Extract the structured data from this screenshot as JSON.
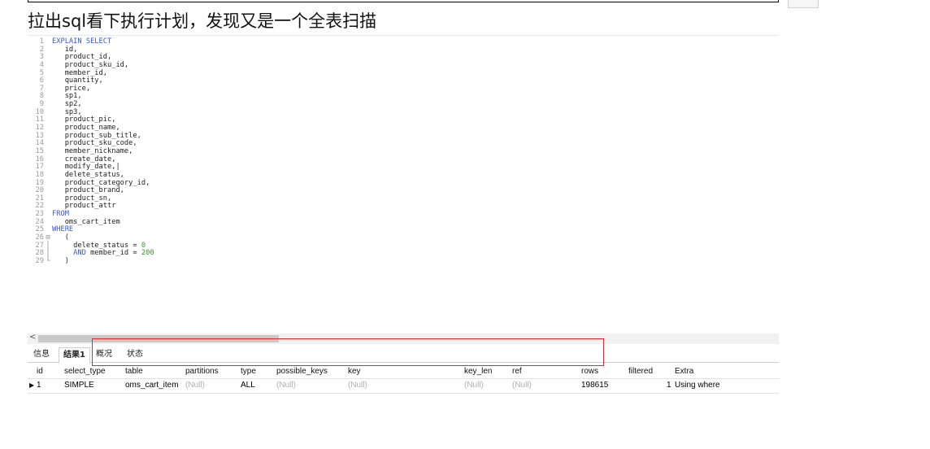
{
  "heading": "拉出sql看下执行计划，发现又是一个全表扫描",
  "editor": {
    "lines": [
      {
        "n": "1",
        "fold": "",
        "parts": [
          {
            "t": "EXPLAIN SELECT",
            "c": "kw"
          }
        ]
      },
      {
        "n": "2",
        "fold": "",
        "parts": [
          {
            "t": "   id,",
            "c": "txt"
          }
        ]
      },
      {
        "n": "3",
        "fold": "",
        "parts": [
          {
            "t": "   product_id,",
            "c": "txt"
          }
        ]
      },
      {
        "n": "4",
        "fold": "",
        "parts": [
          {
            "t": "   product_sku_id,",
            "c": "txt"
          }
        ]
      },
      {
        "n": "5",
        "fold": "",
        "parts": [
          {
            "t": "   member_id,",
            "c": "txt"
          }
        ]
      },
      {
        "n": "6",
        "fold": "",
        "parts": [
          {
            "t": "   quantity,",
            "c": "txt"
          }
        ]
      },
      {
        "n": "7",
        "fold": "",
        "parts": [
          {
            "t": "   price,",
            "c": "txt"
          }
        ]
      },
      {
        "n": "8",
        "fold": "",
        "parts": [
          {
            "t": "   sp1,",
            "c": "txt"
          }
        ]
      },
      {
        "n": "9",
        "fold": "",
        "parts": [
          {
            "t": "   sp2,",
            "c": "txt"
          }
        ]
      },
      {
        "n": "10",
        "fold": "",
        "parts": [
          {
            "t": "   sp3,",
            "c": "txt"
          }
        ]
      },
      {
        "n": "11",
        "fold": "",
        "parts": [
          {
            "t": "   product_pic,",
            "c": "txt"
          }
        ]
      },
      {
        "n": "12",
        "fold": "",
        "parts": [
          {
            "t": "   product_name,",
            "c": "txt"
          }
        ]
      },
      {
        "n": "13",
        "fold": "",
        "parts": [
          {
            "t": "   product_sub_title,",
            "c": "txt"
          }
        ]
      },
      {
        "n": "14",
        "fold": "",
        "parts": [
          {
            "t": "   product_sku_code,",
            "c": "txt"
          }
        ]
      },
      {
        "n": "15",
        "fold": "",
        "parts": [
          {
            "t": "   member_nickname,",
            "c": "txt"
          }
        ]
      },
      {
        "n": "16",
        "fold": "",
        "parts": [
          {
            "t": "   create_date,",
            "c": "txt"
          }
        ]
      },
      {
        "n": "17",
        "fold": "",
        "parts": [
          {
            "t": "   modify_date,|",
            "c": "txt"
          }
        ]
      },
      {
        "n": "18",
        "fold": "",
        "parts": [
          {
            "t": "   delete_status,",
            "c": "txt"
          }
        ]
      },
      {
        "n": "19",
        "fold": "",
        "parts": [
          {
            "t": "   product_category_id,",
            "c": "txt"
          }
        ]
      },
      {
        "n": "20",
        "fold": "",
        "parts": [
          {
            "t": "   product_brand,",
            "c": "txt"
          }
        ]
      },
      {
        "n": "21",
        "fold": "",
        "parts": [
          {
            "t": "   product_sn,",
            "c": "txt"
          }
        ]
      },
      {
        "n": "22",
        "fold": "",
        "parts": [
          {
            "t": "   product_attr",
            "c": "txt"
          }
        ]
      },
      {
        "n": "23",
        "fold": "",
        "parts": [
          {
            "t": "FROM",
            "c": "kw"
          }
        ]
      },
      {
        "n": "24",
        "fold": "",
        "parts": [
          {
            "t": "   oms_cart_item",
            "c": "txt"
          }
        ]
      },
      {
        "n": "25",
        "fold": "",
        "parts": [
          {
            "t": "WHERE",
            "c": "kw"
          }
        ]
      },
      {
        "n": "26",
        "fold": "⊟",
        "parts": [
          {
            "t": "   (",
            "c": "txt"
          }
        ]
      },
      {
        "n": "27",
        "fold": "│",
        "parts": [
          {
            "t": "     delete_status = ",
            "c": "txt"
          },
          {
            "t": "0",
            "c": "num"
          }
        ]
      },
      {
        "n": "28",
        "fold": "│",
        "parts": [
          {
            "t": "     ",
            "c": "txt"
          },
          {
            "t": "AND",
            "c": "kw"
          },
          {
            "t": " member_id = ",
            "c": "txt"
          },
          {
            "t": "200",
            "c": "num"
          }
        ]
      },
      {
        "n": "29",
        "fold": "└",
        "parts": [
          {
            "t": "   )",
            "c": "txt"
          }
        ]
      }
    ]
  },
  "scrollbar": {
    "left_arrow": "<"
  },
  "tabs": [
    {
      "label": "信息",
      "active": false
    },
    {
      "label": "结果1",
      "active": true
    },
    {
      "label": "概况",
      "active": false
    },
    {
      "label": "状态",
      "active": false
    }
  ],
  "grid": {
    "columns": [
      "id",
      "select_type",
      "table",
      "partitions",
      "type",
      "possible_keys",
      "key",
      "key_len",
      "ref",
      "rows",
      "filtered",
      "Extra"
    ],
    "row": {
      "marker": "▶",
      "id": "1",
      "select_type": "SIMPLE",
      "table": "oms_cart_item",
      "partitions": "(Null)",
      "type": "ALL",
      "possible_keys": "(Null)",
      "key": "(Null)",
      "key_len": "(Null)",
      "ref": "(Null)",
      "rows": "198615",
      "filtered": "1",
      "Extra": "Using where"
    }
  },
  "colors": {
    "highlight": "#e0292b",
    "keyword": "#3b57d6",
    "number": "#2e9a2e"
  }
}
